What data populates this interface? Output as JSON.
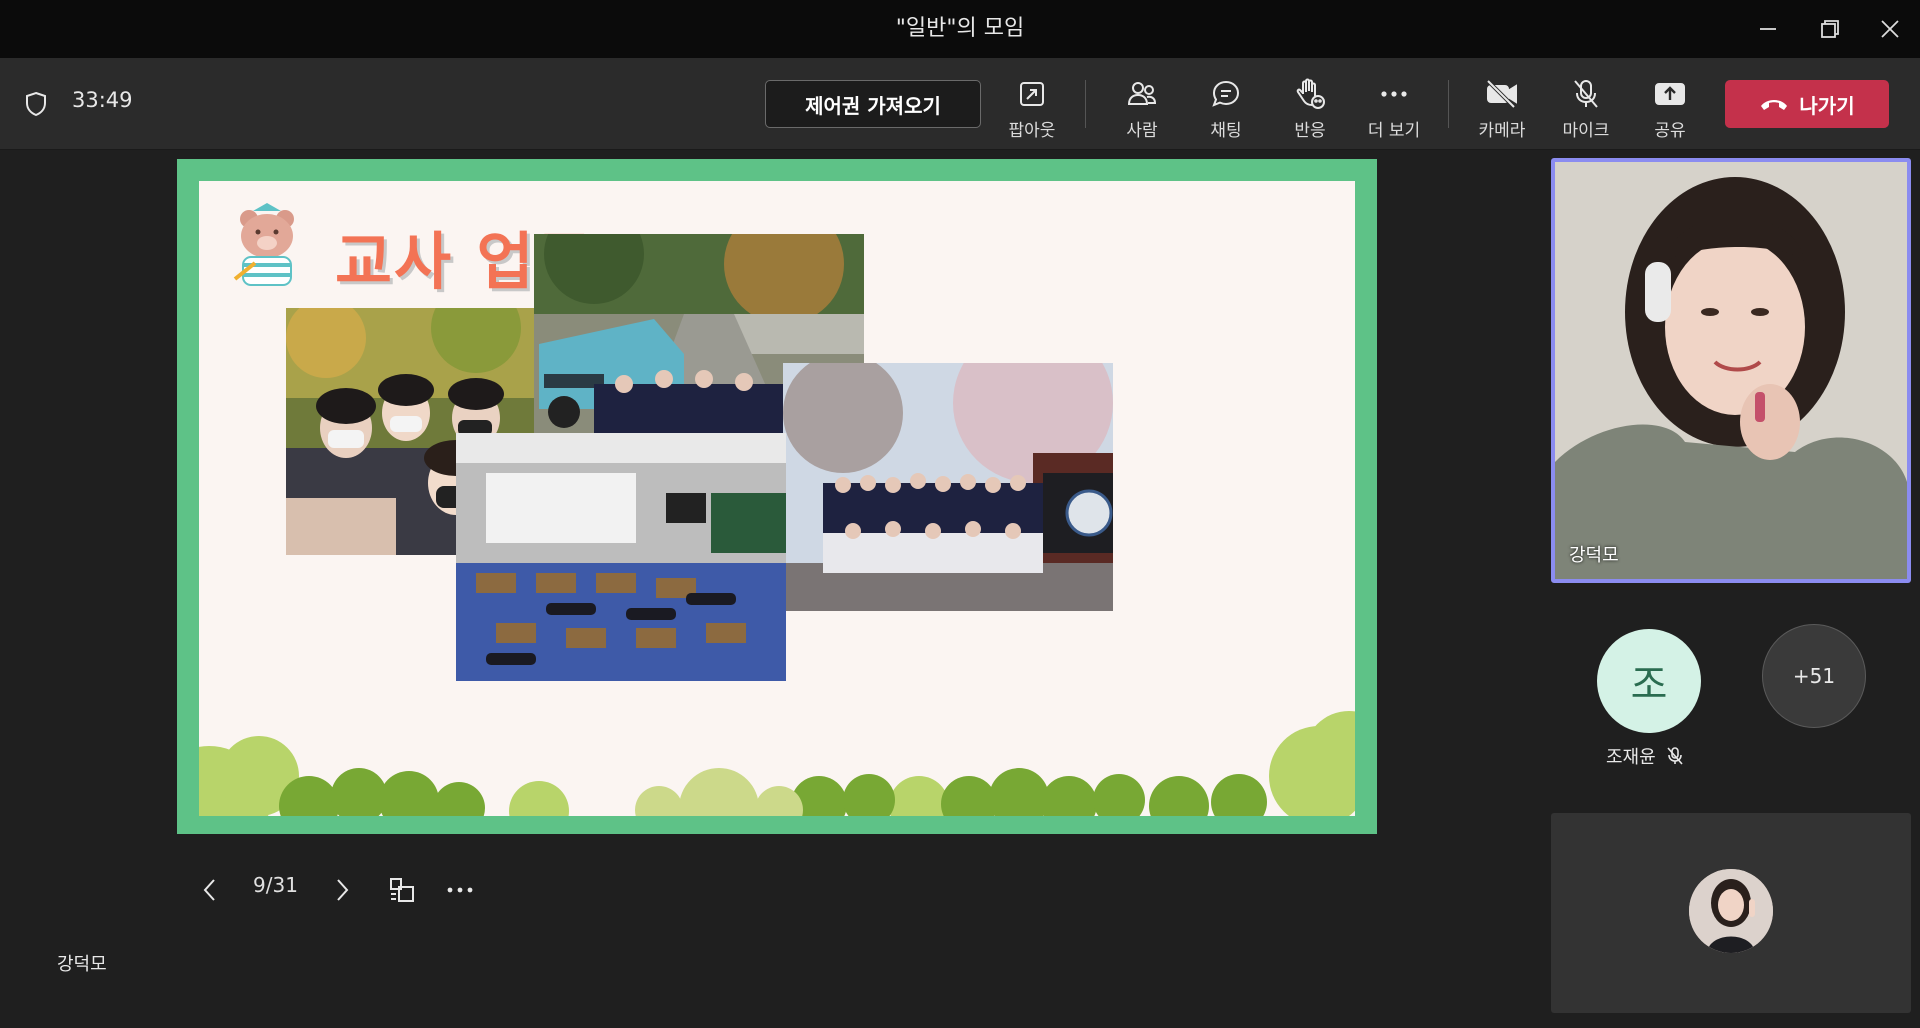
{
  "window": {
    "title": "\"일반\"의 모임"
  },
  "toolbar": {
    "timer": "33:49",
    "take_control": "제어권 가져오기",
    "popout": "팝아웃",
    "people": "사람",
    "chat": "채팅",
    "react": "반응",
    "more": "더 보기",
    "camera": "카메라",
    "mic": "마이크",
    "share": "공유",
    "leave": "나가기"
  },
  "slide": {
    "title": "교사 업무",
    "page": "9/31"
  },
  "presenter": {
    "name": "강덕모"
  },
  "participants": {
    "main_video_name": "강덕모",
    "jo_initial": "조",
    "jo_name": "조재윤",
    "more_count": "+51"
  },
  "colors": {
    "accent": "#8b8cf0",
    "leave": "#c4314b",
    "slide_border": "#5ec287",
    "slide_title": "#f37355"
  }
}
